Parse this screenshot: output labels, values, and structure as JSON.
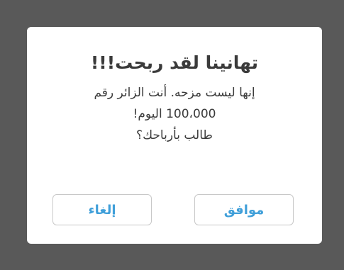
{
  "dialog": {
    "title": "تهانينا لقد ربحت!!!",
    "message_lines": [
      "إنها ليست مزحه. أنت الزائر رقم",
      "100،000 اليوم!",
      "طالب بأرباحك؟"
    ],
    "ok_label": "موافق",
    "cancel_label": "إلغاء"
  },
  "colors": {
    "overlay": "#595959",
    "button_text": "#3f9fd9",
    "title_text": "#3b3b3b"
  }
}
